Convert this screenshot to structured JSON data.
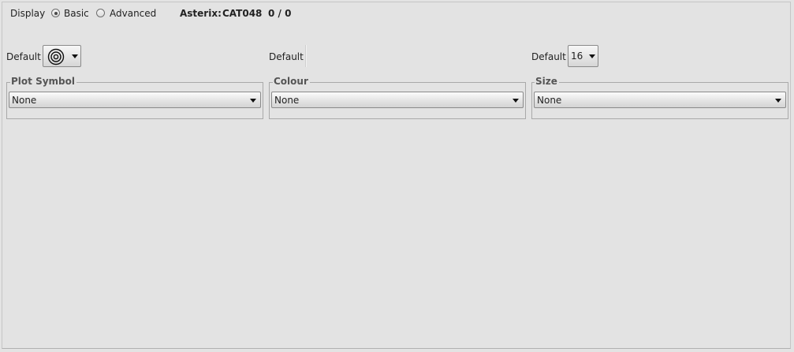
{
  "toolbar": {
    "display_label": "Display",
    "mode_basic": "Basic",
    "mode_advanced": "Advanced",
    "selected_mode": "Basic",
    "catalog_prefix": "Asterix:",
    "catalog_name": "CAT048",
    "record_count": "0 / 0"
  },
  "defaults": {
    "symbol_label": "Default",
    "symbol_icon": "concentric-circles-icon",
    "colour_label": "Default",
    "size_label": "Default",
    "size_value": "16"
  },
  "groups": {
    "plot_symbol": {
      "title": "Plot Symbol",
      "value": "None"
    },
    "colour": {
      "title": "Colour",
      "value": "None"
    },
    "size": {
      "title": "Size",
      "value": "None"
    }
  },
  "colors": {
    "background": "#e3e3e3",
    "border": "#a9a9a9",
    "title_text": "#555555"
  }
}
